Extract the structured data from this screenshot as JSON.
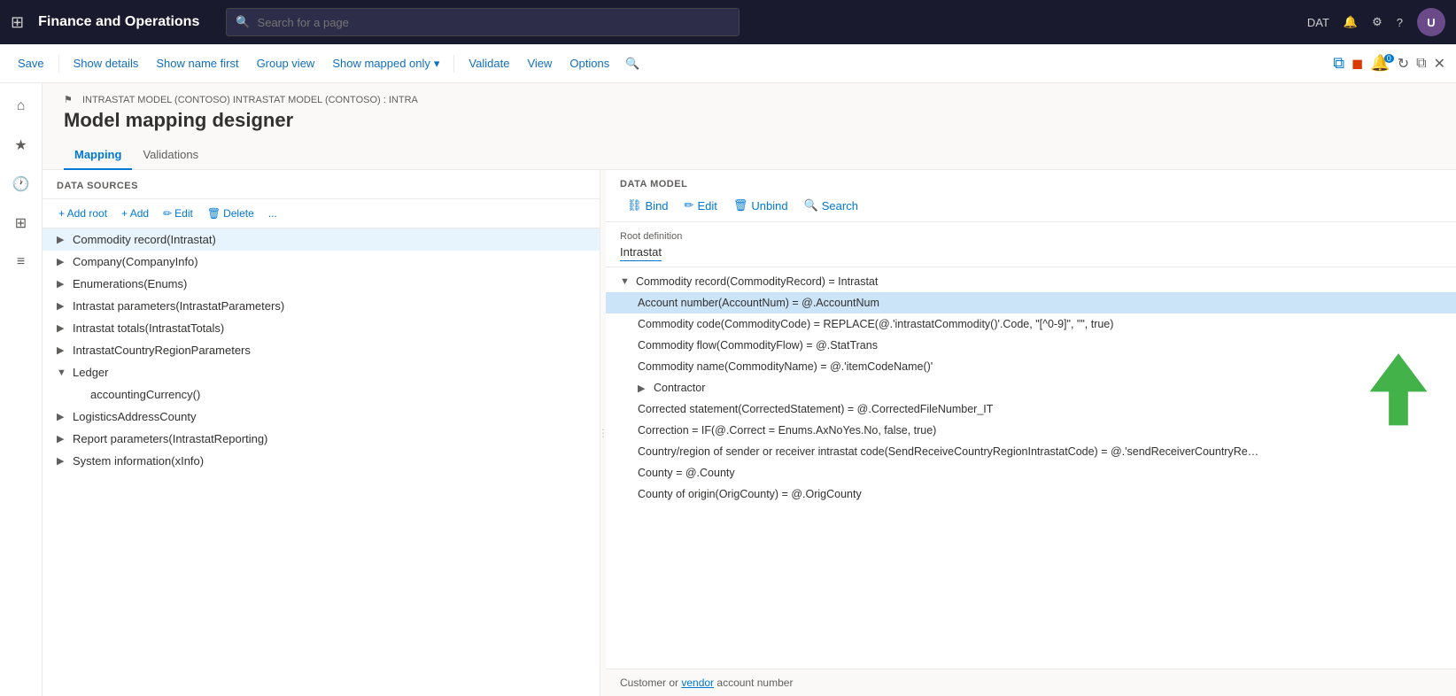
{
  "app": {
    "title": "Finance and Operations",
    "env": "DAT"
  },
  "search": {
    "placeholder": "Search for a page"
  },
  "toolbar": {
    "save": "Save",
    "showDetails": "Show details",
    "showNameFirst": "Show name first",
    "groupView": "Group view",
    "showMappedOnly": "Show mapped only",
    "validate": "Validate",
    "view": "View",
    "options": "Options"
  },
  "page": {
    "breadcrumb": "INTRASTAT MODEL (CONTOSO) INTRASTAT MODEL (CONTOSO) : INTRA",
    "title": "Model mapping designer"
  },
  "tabs": [
    {
      "id": "mapping",
      "label": "Mapping",
      "active": true
    },
    {
      "id": "validations",
      "label": "Validations",
      "active": false
    }
  ],
  "dataSourcesPanel": {
    "header": "DATA SOURCES",
    "addRoot": "+ Add root",
    "add": "+ Add",
    "edit": "Edit",
    "delete": "Delete",
    "more": "...",
    "items": [
      {
        "id": "commodity-record",
        "label": "Commodity record(Intrastat)",
        "level": 0,
        "expanded": true,
        "selected": true
      },
      {
        "id": "company",
        "label": "Company(CompanyInfo)",
        "level": 0,
        "expanded": false
      },
      {
        "id": "enumerations",
        "label": "Enumerations(Enums)",
        "level": 0,
        "expanded": false
      },
      {
        "id": "intrastat-params",
        "label": "Intrastat parameters(IntrastatParameters)",
        "level": 0,
        "expanded": false
      },
      {
        "id": "intrastat-totals",
        "label": "Intrastat totals(IntrastatTotals)",
        "level": 0,
        "expanded": false
      },
      {
        "id": "intrastatcountry",
        "label": "IntrastatCountryRegionParameters",
        "level": 0,
        "expanded": false
      },
      {
        "id": "ledger",
        "label": "Ledger",
        "level": 0,
        "expanded": true,
        "hasChildren": true
      },
      {
        "id": "accounting-currency",
        "label": "accountingCurrency()",
        "level": 1,
        "expanded": false
      },
      {
        "id": "logistics-address",
        "label": "LogisticsAddressCounty",
        "level": 0,
        "expanded": false
      },
      {
        "id": "report-params",
        "label": "Report parameters(IntrastatReporting)",
        "level": 0,
        "expanded": false
      },
      {
        "id": "system-info",
        "label": "System information(xInfo)",
        "level": 0,
        "expanded": false
      }
    ]
  },
  "dataModelPanel": {
    "header": "DATA MODEL",
    "bind": "Bind",
    "edit": "Edit",
    "unbind": "Unbind",
    "search": "Search",
    "rootDefinitionLabel": "Root definition",
    "rootDefinitionValue": "Intrastat",
    "items": [
      {
        "id": "commodity-record-parent",
        "label": "Commodity record(CommodityRecord) = Intrastat",
        "level": 0,
        "toggle": "▼"
      },
      {
        "id": "account-number",
        "label": "Account number(AccountNum) = @.AccountNum",
        "level": 1,
        "selected": true
      },
      {
        "id": "commodity-code",
        "label": "Commodity code(CommodityCode) = REPLACE(@.'intrastatCommodity()'.Code, \"[^0-9]\", \"\", true)",
        "level": 1
      },
      {
        "id": "commodity-flow",
        "label": "Commodity flow(CommodityFlow) = @.StatTrans",
        "level": 1
      },
      {
        "id": "commodity-name",
        "label": "Commodity name(CommodityName) = @.'itemCodeName()'",
        "level": 1
      },
      {
        "id": "contractor",
        "label": "Contractor",
        "level": 1,
        "toggle": "▶"
      },
      {
        "id": "corrected-statement",
        "label": "Corrected statement(CorrectedStatement) = @.CorrectedFileNumber_IT",
        "level": 1
      },
      {
        "id": "correction",
        "label": "Correction = IF(@.Correct = Enums.AxNoYes.No, false, true)",
        "level": 1
      },
      {
        "id": "country-region",
        "label": "Country/region of sender or receiver intrastat code(SendReceiveCountryRegionIntrastatCode) = @.'sendReceiverCountryRe…",
        "level": 1
      },
      {
        "id": "county",
        "label": "County = @.County",
        "level": 1
      },
      {
        "id": "county-of-origin",
        "label": "County of origin(OrigCounty) = @.OrigCounty",
        "level": 1
      }
    ]
  },
  "bottomBar": {
    "text": "Customer or vendor account number"
  }
}
